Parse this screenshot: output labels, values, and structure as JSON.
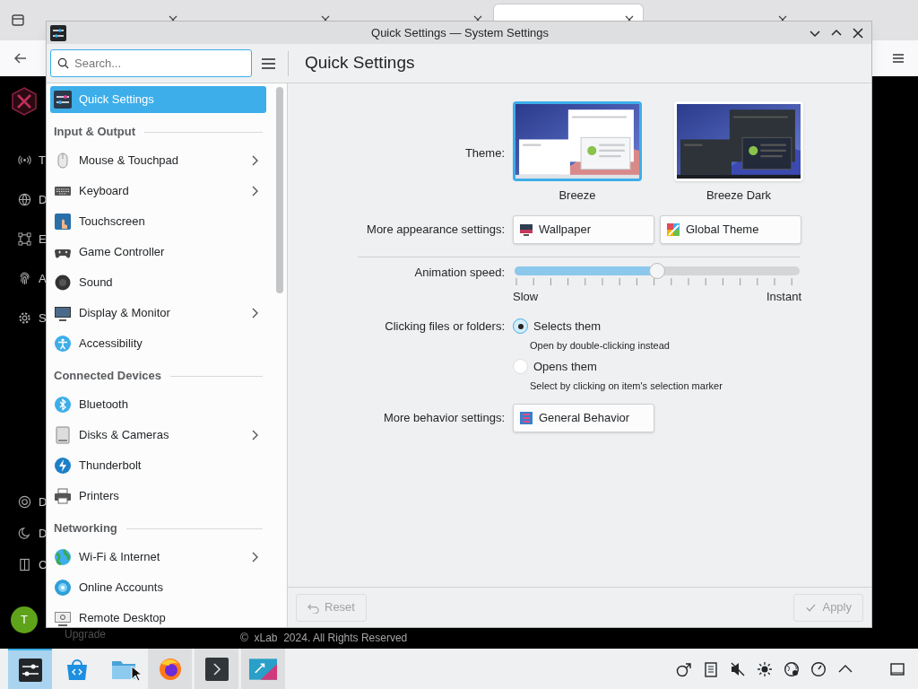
{
  "browser": {
    "tabs": [
      {
        "selected": false
      },
      {
        "selected": false
      },
      {
        "selected": false
      },
      {
        "selected": true
      },
      {
        "selected": false
      }
    ],
    "page": {
      "nav_letters": [
        "T",
        "D",
        "E",
        "A",
        "S"
      ],
      "bottom_letters": [
        "D",
        "D",
        "C"
      ],
      "avatar": "T",
      "upgrade": "Upgrade",
      "footer": "©  xLab  2024. All Rights Reserved"
    }
  },
  "window": {
    "title": "Quick Settings — System Settings",
    "search": {
      "placeholder": "Search..."
    },
    "page_title": "Quick Settings",
    "sidebar": {
      "items": [
        {
          "kind": "item",
          "label": "Quick Settings",
          "selected": true,
          "expandable": false
        },
        {
          "kind": "section",
          "label": "Input & Output"
        },
        {
          "kind": "item",
          "label": "Mouse & Touchpad",
          "selected": false,
          "expandable": true
        },
        {
          "kind": "item",
          "label": "Keyboard",
          "selected": false,
          "expandable": true
        },
        {
          "kind": "item",
          "label": "Touchscreen",
          "selected": false,
          "expandable": false
        },
        {
          "kind": "item",
          "label": "Game Controller",
          "selected": false,
          "expandable": false
        },
        {
          "kind": "item",
          "label": "Sound",
          "selected": false,
          "expandable": false
        },
        {
          "kind": "item",
          "label": "Display & Monitor",
          "selected": false,
          "expandable": true
        },
        {
          "kind": "item",
          "label": "Accessibility",
          "selected": false,
          "expandable": false
        },
        {
          "kind": "section",
          "label": "Connected Devices"
        },
        {
          "kind": "item",
          "label": "Bluetooth",
          "selected": false,
          "expandable": false
        },
        {
          "kind": "item",
          "label": "Disks & Cameras",
          "selected": false,
          "expandable": true
        },
        {
          "kind": "item",
          "label": "Thunderbolt",
          "selected": false,
          "expandable": false
        },
        {
          "kind": "item",
          "label": "Printers",
          "selected": false,
          "expandable": false
        },
        {
          "kind": "section",
          "label": "Networking"
        },
        {
          "kind": "item",
          "label": "Wi-Fi & Internet",
          "selected": false,
          "expandable": true
        },
        {
          "kind": "item",
          "label": "Online Accounts",
          "selected": false,
          "expandable": false
        },
        {
          "kind": "item",
          "label": "Remote Desktop",
          "selected": false,
          "expandable": false
        }
      ]
    },
    "content": {
      "theme": {
        "label": "Theme:",
        "options": [
          {
            "name": "Breeze",
            "selected": true
          },
          {
            "name": "Breeze Dark",
            "selected": false
          }
        ]
      },
      "appearance": {
        "label": "More appearance settings:",
        "buttons": [
          "Wallpaper",
          "Global Theme"
        ]
      },
      "animation": {
        "label": "Animation speed:",
        "level": 0.5,
        "min_label": "Slow",
        "max_label": "Instant"
      },
      "clicking": {
        "label": "Clicking files or folders:",
        "options": [
          {
            "label": "Selects them",
            "hint": "Open by double-clicking instead",
            "selected": true
          },
          {
            "label": "Opens them",
            "hint": "Select by clicking on item's selection marker",
            "selected": false
          }
        ]
      },
      "behavior": {
        "label": "More behavior settings:",
        "button": "General Behavior"
      }
    },
    "footer": {
      "buttons": [
        {
          "label": "Reset",
          "disabled": true
        },
        {
          "label": "Apply",
          "disabled": true
        }
      ]
    }
  },
  "taskbar": {
    "apps": [
      {
        "selected": true
      },
      {
        "selected": false,
        "running": false
      },
      {
        "selected": false,
        "running": false
      },
      {
        "selected": false,
        "running": true
      },
      {
        "selected": false,
        "running": true
      },
      {
        "selected": false,
        "running": true
      }
    ]
  }
}
